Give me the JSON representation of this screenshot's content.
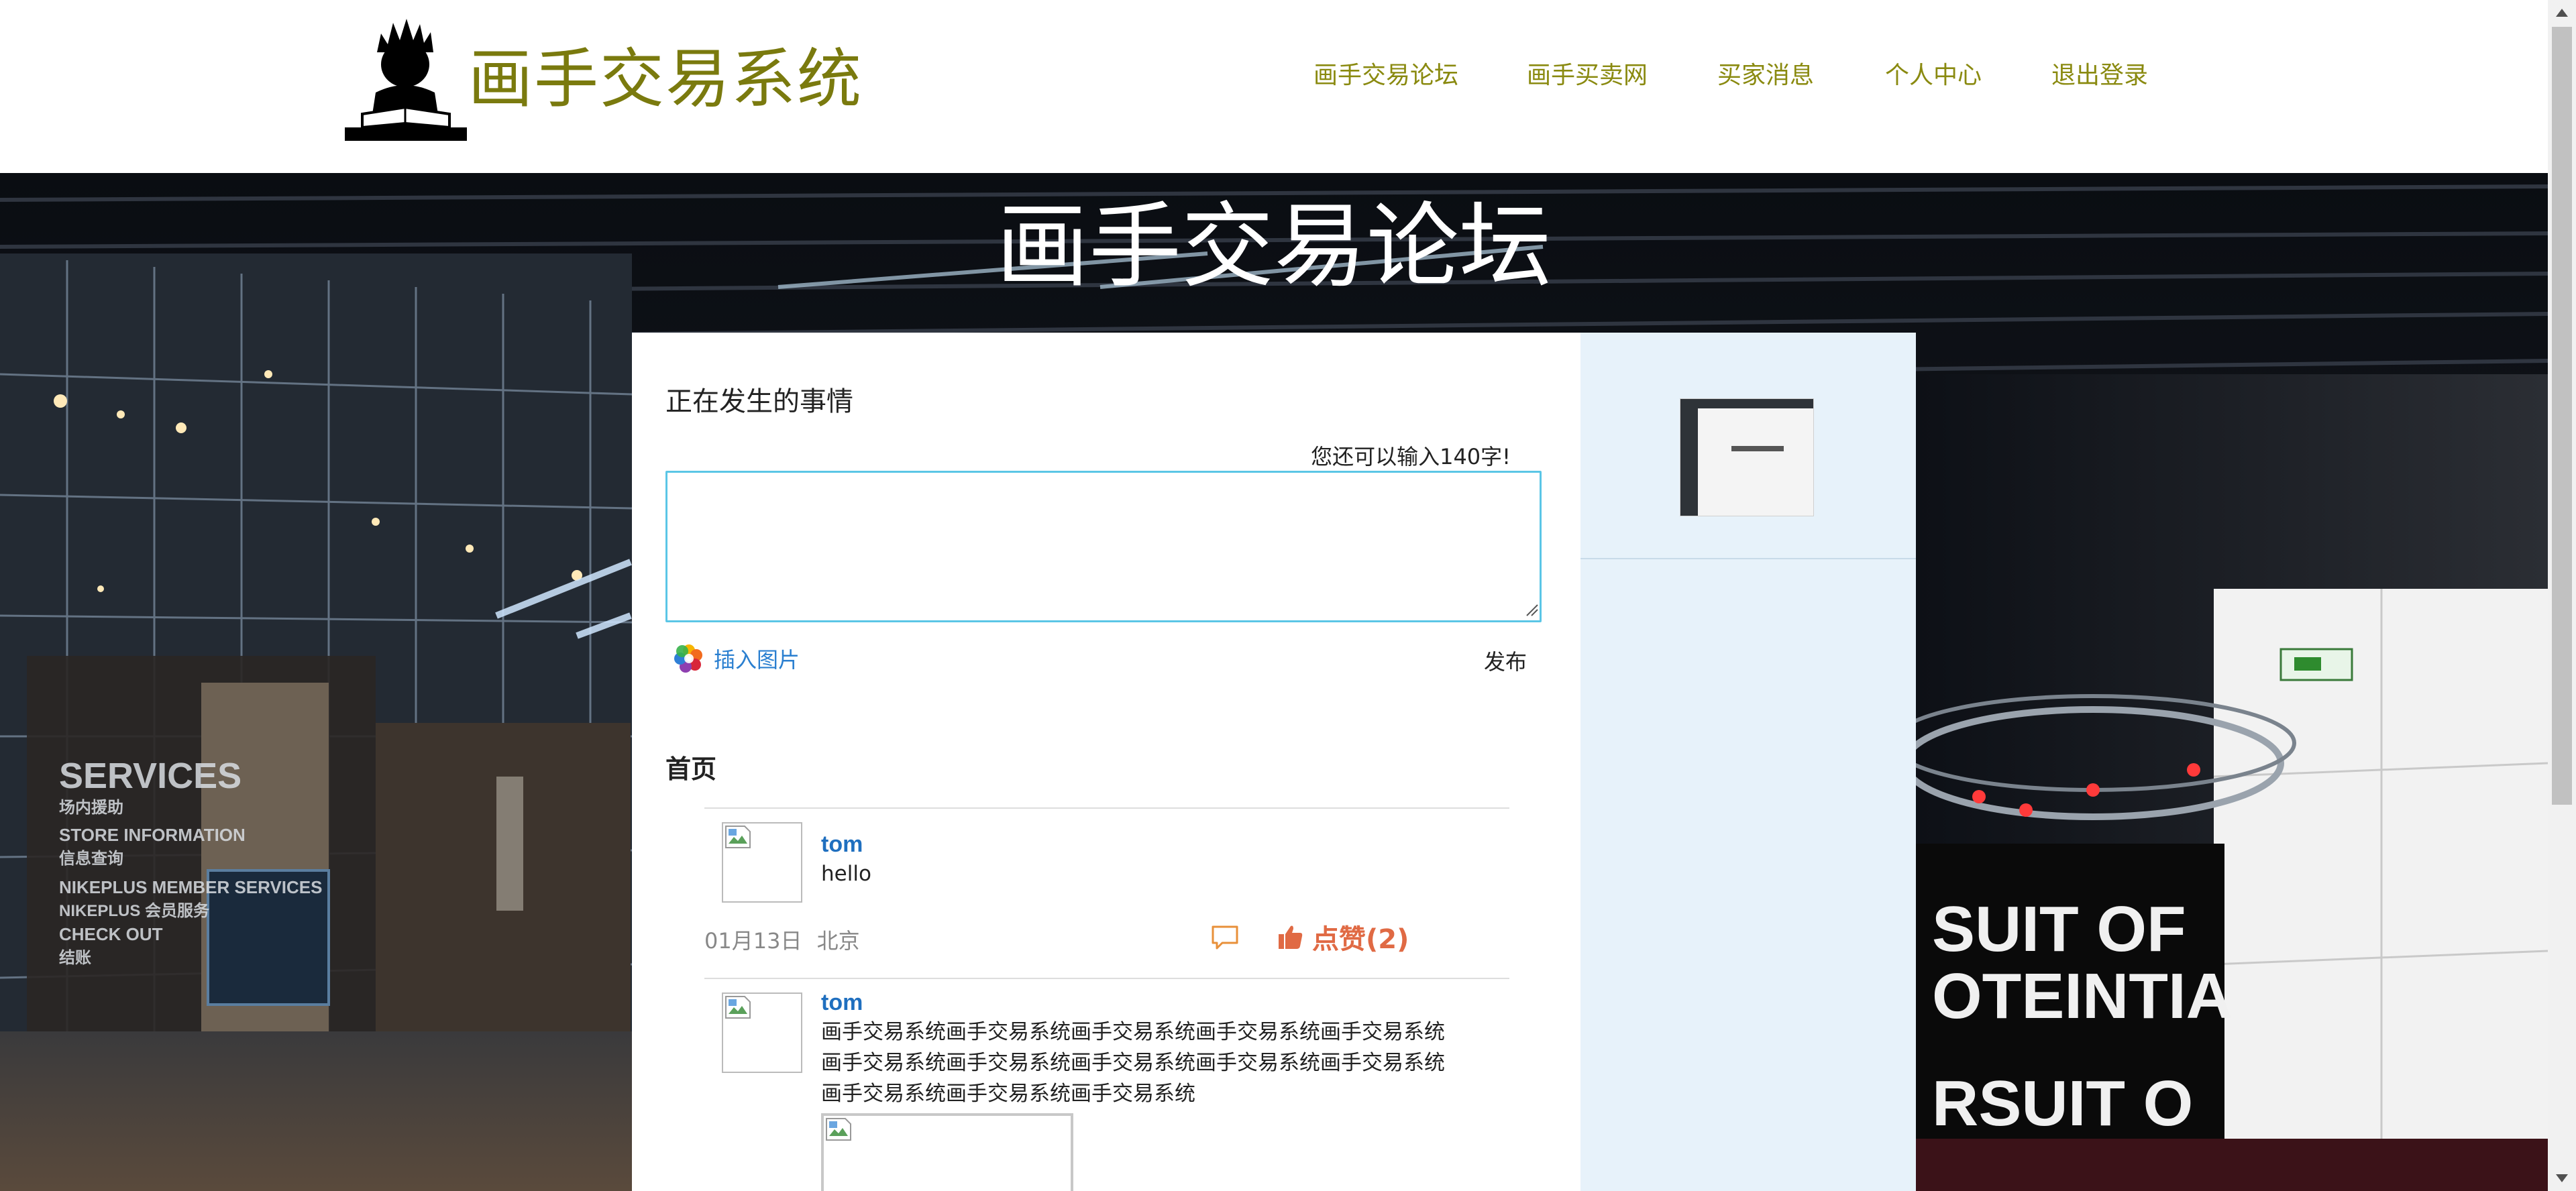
{
  "header": {
    "brand": "画手交易系统",
    "nav": [
      {
        "label": "画手交易论坛"
      },
      {
        "label": "画手买卖网"
      },
      {
        "label": "买家消息"
      },
      {
        "label": "个人中心"
      },
      {
        "label": "退出登录"
      }
    ]
  },
  "hero": {
    "title": "画手交易论坛",
    "store_signs": [
      "SERVICES",
      "场内援助",
      "STORE INFORMATION",
      "信息查询",
      "NIKEPLUS MEMBER SERVICES",
      "NIKEPLUS 会员服务",
      "CHECK OUT",
      "结账"
    ]
  },
  "composer": {
    "title": "正在发生的事情",
    "counter": "您还可以输入140字!",
    "value": "",
    "insert_image": "插入图片",
    "publish": "发布"
  },
  "feed": {
    "title": "首页",
    "posts": [
      {
        "author": "tom",
        "text": "hello",
        "date": "01月13日",
        "location": "北京",
        "like_label": "点赞(2)"
      },
      {
        "author": "tom",
        "text": "画手交易系统画手交易系统画手交易系统画手交易系统画手交易系统画手交易系统画手交易系统画手交易系统画手交易系统画手交易系统画手交易系统画手交易系统画手交易系统"
      }
    ]
  },
  "colors": {
    "brand": "#7a7a0e",
    "nav": "#8a8a10",
    "link": "#1f6fbf",
    "like": "#e06a44",
    "sidebar": "#e7f2fa",
    "input_focus": "#5bc6e6"
  }
}
